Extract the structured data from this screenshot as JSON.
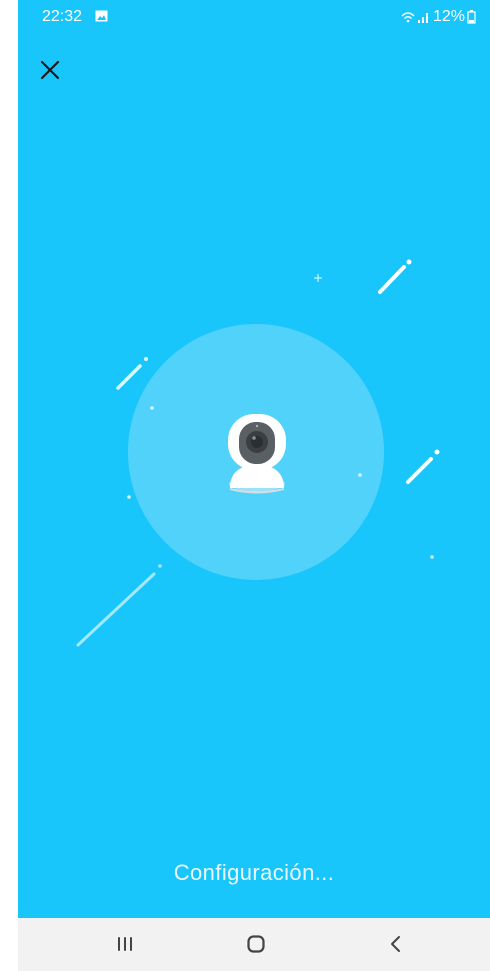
{
  "status_bar": {
    "time": "22:32",
    "battery": "12%",
    "icons": [
      "gallery-icon",
      "wifi-icon",
      "signal-icon",
      "battery-icon"
    ]
  },
  "header": {
    "close_icon": "close-icon"
  },
  "main": {
    "device": "camera-icon",
    "status_text": "Configuración..."
  },
  "nav": {
    "icons": [
      "recent-apps-icon",
      "home-icon",
      "back-icon"
    ]
  },
  "colors": {
    "background": "#19c6fb",
    "circle": "#5ed5fb",
    "nav_bar": "#f2f2f2"
  }
}
